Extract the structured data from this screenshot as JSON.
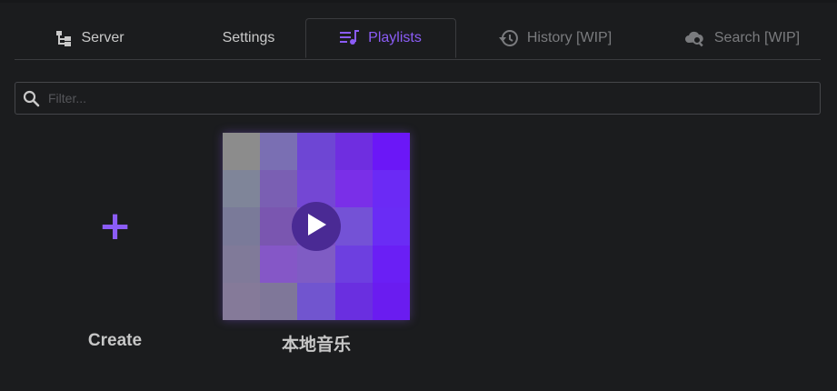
{
  "tabs": [
    {
      "label": "Server",
      "icon": "server-tree-icon",
      "state": "normal"
    },
    {
      "label": "Settings",
      "icon": "",
      "state": "normal"
    },
    {
      "label": "Playlists",
      "icon": "playlist-music-icon",
      "state": "active"
    },
    {
      "label": "History [WIP]",
      "icon": "history-icon",
      "state": "disabled"
    },
    {
      "label": "Search [WIP]",
      "icon": "cloud-search-icon",
      "state": "disabled"
    }
  ],
  "filter": {
    "placeholder": "Filter...",
    "value": ""
  },
  "create": {
    "label": "Create",
    "symbol": "+"
  },
  "playlists": [
    {
      "name": "本地音乐"
    }
  ],
  "colors": {
    "accent": "#8b5cf6",
    "background": "#1b1c1e",
    "cover_grid": [
      [
        "#8c8c8c",
        "#7a6fb3",
        "#6e46d4",
        "#6f2ee0",
        "#6b17f7"
      ],
      [
        "#7f8599",
        "#7a5fb3",
        "#7447d4",
        "#7a2fe8",
        "#6b2af5"
      ],
      [
        "#7a7a99",
        "#7a56b0",
        "#7e52c4",
        "#7452d6",
        "#6a2cf5"
      ],
      [
        "#807a99",
        "#8557c7",
        "#7f5cc4",
        "#6d3fe0",
        "#6a1ff5"
      ],
      [
        "#857a99",
        "#7f7799",
        "#7155cf",
        "#6a2fe0",
        "#6a1cf0"
      ]
    ]
  }
}
